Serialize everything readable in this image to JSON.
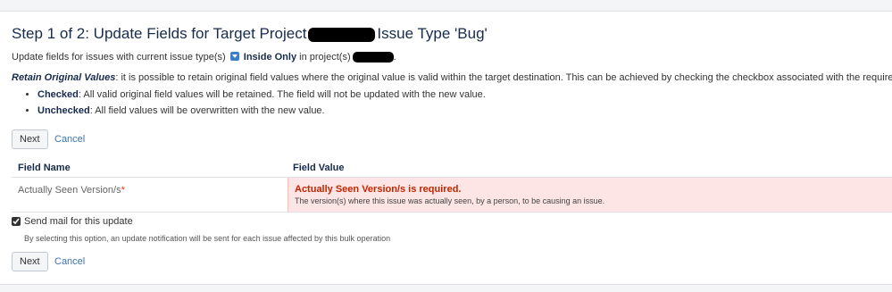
{
  "title": {
    "prefix": "Step 1 of 2: Update Fields for Target Project",
    "suffix": "Issue Type 'Bug'"
  },
  "intro": {
    "text_before": "Update fields for issues with current issue type(s)",
    "issue_type": "Inside Only",
    "text_after": "in project(s)",
    "trailing": "."
  },
  "retain": {
    "term": "Retain Original Values",
    "text": ": it is possible to retain original field values where the original value is valid within the target destination. This can be achieved by checking the checkbox associated with the required field"
  },
  "bullets": [
    {
      "term": "Checked",
      "text": ": All valid original field values will be retained. The field will not be updated with the new value."
    },
    {
      "term": "Unchecked",
      "text": ": All field values will be overwritten with the new value."
    }
  ],
  "actions_top": {
    "next": "Next",
    "cancel": "Cancel"
  },
  "table": {
    "headers": {
      "field_name": "Field Name",
      "field_value": "Field Value"
    },
    "rows": [
      {
        "field_name": "Actually Seen Version/s",
        "required_marker": "*",
        "error_title": "Actually Seen Version/s is required.",
        "error_desc": "The version(s) where this issue was actually seen, by a person, to be causing an issue."
      }
    ]
  },
  "send_mail": {
    "label": "Send mail for this update",
    "checked": true,
    "description": "By selecting this option, an update notification will be sent for each issue affected by this bulk operation"
  },
  "actions_bottom": {
    "next": "Next",
    "cancel": "Cancel"
  },
  "colors": {
    "link": "#3b73af",
    "error_bg": "#fde5e5",
    "error_text": "#bf2600",
    "issue_icon": "#3b7fc4"
  }
}
